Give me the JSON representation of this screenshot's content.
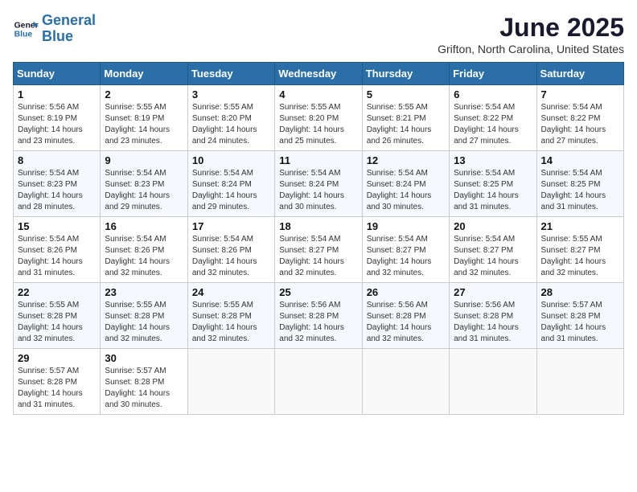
{
  "header": {
    "logo_line1": "General",
    "logo_line2": "Blue",
    "month": "June 2025",
    "location": "Grifton, North Carolina, United States"
  },
  "weekdays": [
    "Sunday",
    "Monday",
    "Tuesday",
    "Wednesday",
    "Thursday",
    "Friday",
    "Saturday"
  ],
  "weeks": [
    [
      {
        "day": "1",
        "sunrise": "5:56 AM",
        "sunset": "8:19 PM",
        "daylight": "14 hours and 23 minutes."
      },
      {
        "day": "2",
        "sunrise": "5:55 AM",
        "sunset": "8:19 PM",
        "daylight": "14 hours and 23 minutes."
      },
      {
        "day": "3",
        "sunrise": "5:55 AM",
        "sunset": "8:20 PM",
        "daylight": "14 hours and 24 minutes."
      },
      {
        "day": "4",
        "sunrise": "5:55 AM",
        "sunset": "8:20 PM",
        "daylight": "14 hours and 25 minutes."
      },
      {
        "day": "5",
        "sunrise": "5:55 AM",
        "sunset": "8:21 PM",
        "daylight": "14 hours and 26 minutes."
      },
      {
        "day": "6",
        "sunrise": "5:54 AM",
        "sunset": "8:22 PM",
        "daylight": "14 hours and 27 minutes."
      },
      {
        "day": "7",
        "sunrise": "5:54 AM",
        "sunset": "8:22 PM",
        "daylight": "14 hours and 27 minutes."
      }
    ],
    [
      {
        "day": "8",
        "sunrise": "5:54 AM",
        "sunset": "8:23 PM",
        "daylight": "14 hours and 28 minutes."
      },
      {
        "day": "9",
        "sunrise": "5:54 AM",
        "sunset": "8:23 PM",
        "daylight": "14 hours and 29 minutes."
      },
      {
        "day": "10",
        "sunrise": "5:54 AM",
        "sunset": "8:24 PM",
        "daylight": "14 hours and 29 minutes."
      },
      {
        "day": "11",
        "sunrise": "5:54 AM",
        "sunset": "8:24 PM",
        "daylight": "14 hours and 30 minutes."
      },
      {
        "day": "12",
        "sunrise": "5:54 AM",
        "sunset": "8:24 PM",
        "daylight": "14 hours and 30 minutes."
      },
      {
        "day": "13",
        "sunrise": "5:54 AM",
        "sunset": "8:25 PM",
        "daylight": "14 hours and 31 minutes."
      },
      {
        "day": "14",
        "sunrise": "5:54 AM",
        "sunset": "8:25 PM",
        "daylight": "14 hours and 31 minutes."
      }
    ],
    [
      {
        "day": "15",
        "sunrise": "5:54 AM",
        "sunset": "8:26 PM",
        "daylight": "14 hours and 31 minutes."
      },
      {
        "day": "16",
        "sunrise": "5:54 AM",
        "sunset": "8:26 PM",
        "daylight": "14 hours and 32 minutes."
      },
      {
        "day": "17",
        "sunrise": "5:54 AM",
        "sunset": "8:26 PM",
        "daylight": "14 hours and 32 minutes."
      },
      {
        "day": "18",
        "sunrise": "5:54 AM",
        "sunset": "8:27 PM",
        "daylight": "14 hours and 32 minutes."
      },
      {
        "day": "19",
        "sunrise": "5:54 AM",
        "sunset": "8:27 PM",
        "daylight": "14 hours and 32 minutes."
      },
      {
        "day": "20",
        "sunrise": "5:54 AM",
        "sunset": "8:27 PM",
        "daylight": "14 hours and 32 minutes."
      },
      {
        "day": "21",
        "sunrise": "5:55 AM",
        "sunset": "8:27 PM",
        "daylight": "14 hours and 32 minutes."
      }
    ],
    [
      {
        "day": "22",
        "sunrise": "5:55 AM",
        "sunset": "8:28 PM",
        "daylight": "14 hours and 32 minutes."
      },
      {
        "day": "23",
        "sunrise": "5:55 AM",
        "sunset": "8:28 PM",
        "daylight": "14 hours and 32 minutes."
      },
      {
        "day": "24",
        "sunrise": "5:55 AM",
        "sunset": "8:28 PM",
        "daylight": "14 hours and 32 minutes."
      },
      {
        "day": "25",
        "sunrise": "5:56 AM",
        "sunset": "8:28 PM",
        "daylight": "14 hours and 32 minutes."
      },
      {
        "day": "26",
        "sunrise": "5:56 AM",
        "sunset": "8:28 PM",
        "daylight": "14 hours and 32 minutes."
      },
      {
        "day": "27",
        "sunrise": "5:56 AM",
        "sunset": "8:28 PM",
        "daylight": "14 hours and 31 minutes."
      },
      {
        "day": "28",
        "sunrise": "5:57 AM",
        "sunset": "8:28 PM",
        "daylight": "14 hours and 31 minutes."
      }
    ],
    [
      {
        "day": "29",
        "sunrise": "5:57 AM",
        "sunset": "8:28 PM",
        "daylight": "14 hours and 31 minutes."
      },
      {
        "day": "30",
        "sunrise": "5:57 AM",
        "sunset": "8:28 PM",
        "daylight": "14 hours and 30 minutes."
      },
      null,
      null,
      null,
      null,
      null
    ]
  ]
}
